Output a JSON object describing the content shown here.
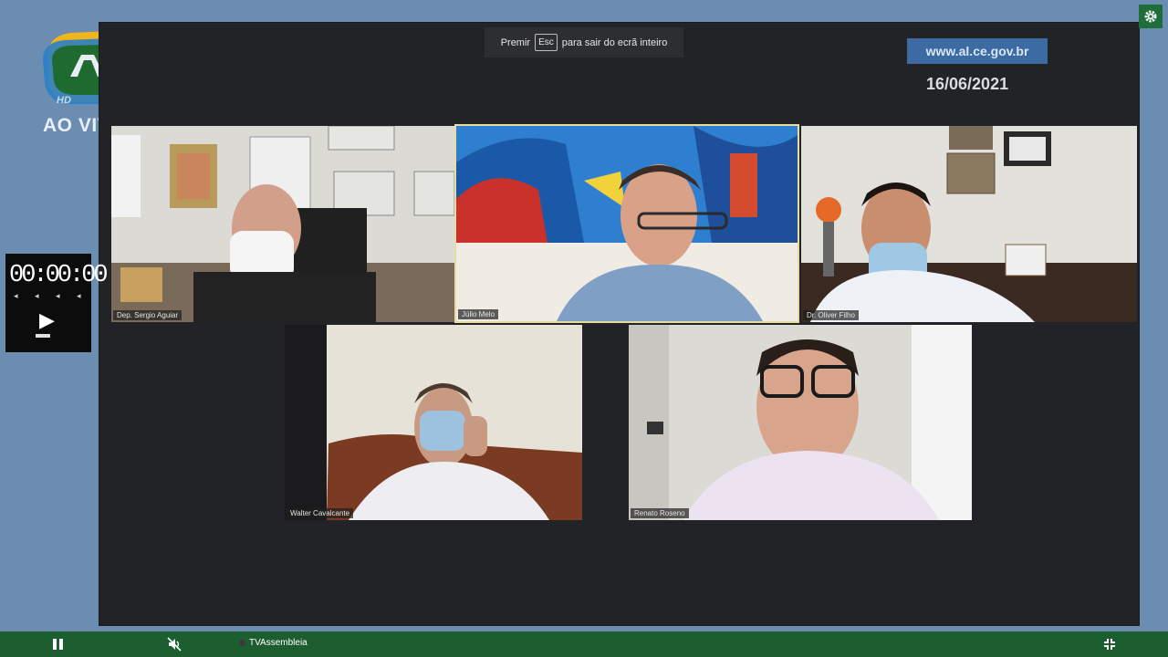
{
  "broadcast": {
    "live_label": "AO VIVO",
    "hd_label": "HD",
    "url": "www.al.ce.gov.br",
    "date": "16/06/2021"
  },
  "fullscreen_tip": {
    "prefix": "Premir",
    "key": "Esc",
    "suffix": "para sair do ecrã inteiro"
  },
  "participants": [
    {
      "name": "Dep. Sergio Aguiar"
    },
    {
      "name": "Júlio Melo"
    },
    {
      "name": "Dr. Oliver Filho"
    },
    {
      "name": "Walter Cavalcante"
    },
    {
      "name": "Renato Roseno"
    }
  ],
  "timer": {
    "value": "00:00:00",
    "sub": "◂ ◂ ◂ ◂"
  },
  "controls": {
    "channel": "TVAssembleia"
  },
  "colors": {
    "bottom_bar": "#1c5e2f",
    "frame": "#6b8db2",
    "active_speaker_border": "#e6dca0"
  },
  "icons": [
    "settings-gear-icon",
    "pause-icon",
    "volume-mute-icon",
    "exit-fullscreen-icon",
    "play-icon"
  ]
}
